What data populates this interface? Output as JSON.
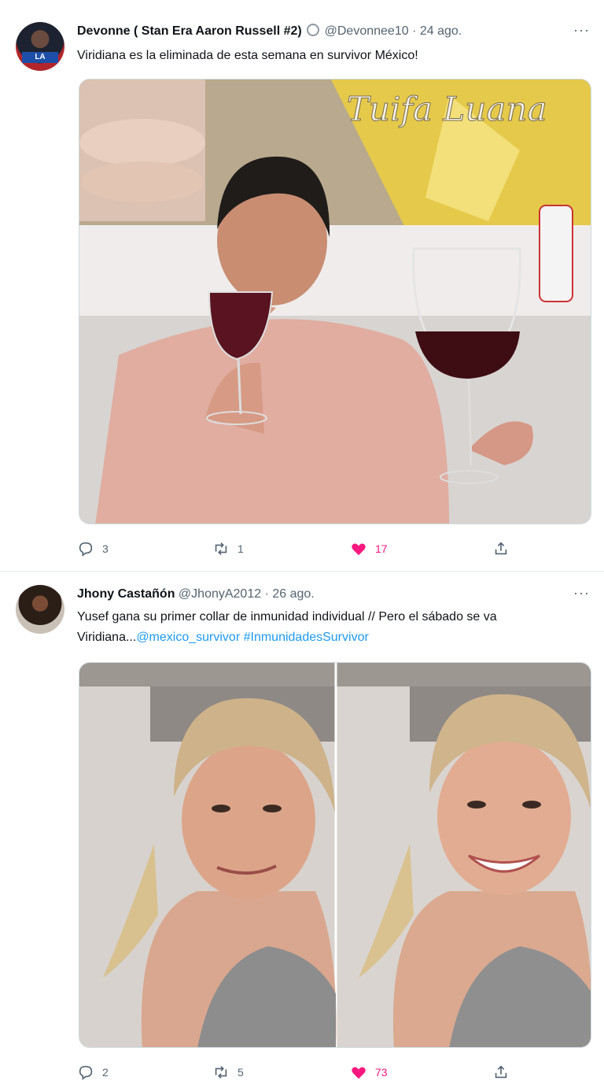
{
  "tweets": [
    {
      "author_name": "Devonne ( Stan Era Aaron Russell #2)",
      "handle": "@Devonnee10",
      "separator": "·",
      "date": "24 ago.",
      "avatar_badge": "LA",
      "text": "Viridiana es la eliminada de esta semana en survivor México!",
      "media_overlay_text": "Tuifa Luana",
      "stats": {
        "replies": "3",
        "retweets": "1",
        "likes": "17"
      },
      "liked": true
    },
    {
      "author_name": "Jhony Castañón",
      "handle": "@JhonyA2012",
      "separator": "·",
      "date": "26 ago.",
      "text_line1": "Yusef gana su primer collar de inmunidad individual // Pero el sábado se va",
      "text_line2_plain": "Viridiana...",
      "mention": "@mexico_survivor",
      "hashtag": "#InmunidadesSurvivor",
      "stats": {
        "replies": "2",
        "retweets": "5",
        "likes": "73"
      },
      "liked": true
    }
  ],
  "more_label": "···",
  "icons": [
    "verified-icon",
    "reply-icon",
    "retweet-icon",
    "like-icon",
    "share-icon",
    "more-icon"
  ],
  "colors": {
    "accent": "#1d9bf0",
    "like": "#f91880",
    "secondary": "#536471",
    "border": "#eff3f4"
  }
}
